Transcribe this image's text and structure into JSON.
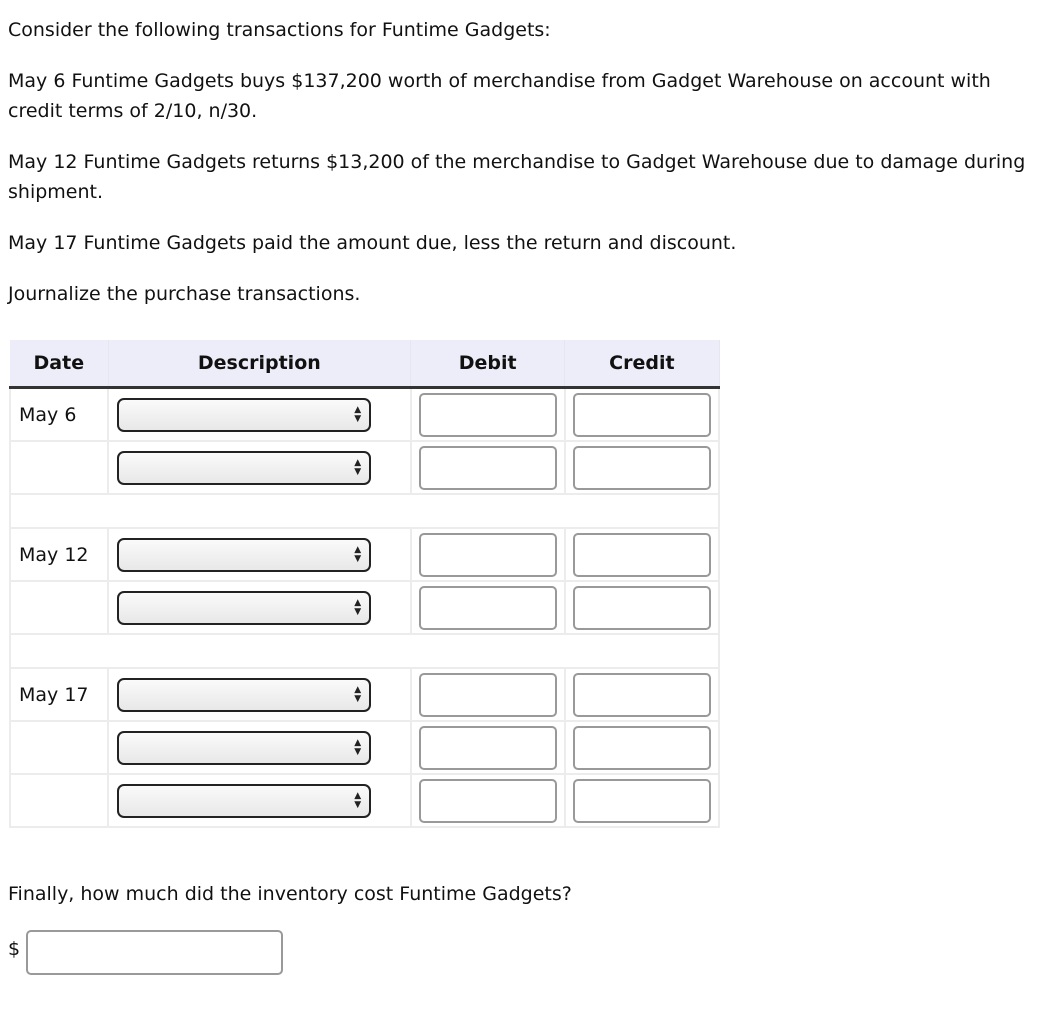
{
  "intro": "Consider the following transactions for Funtime Gadgets:",
  "transactions": [
    "May 6 Funtime Gadgets buys $137,200 worth of merchandise from Gadget Warehouse on account with credit terms of 2/10, n/30.",
    "May 12 Funtime Gadgets returns $13,200 of the merchandise to Gadget Warehouse due to damage during shipment.",
    "May 17 Funtime Gadgets paid the amount due, less the return and discount."
  ],
  "instruction": "Journalize the purchase transactions.",
  "table": {
    "headers": {
      "date": "Date",
      "description": "Description",
      "debit": "Debit",
      "credit": "Credit"
    },
    "dates": [
      "May 6",
      "May 12",
      "May 17"
    ]
  },
  "final_question": "Finally, how much did the inventory cost Funtime Gadgets?",
  "currency_symbol": "$"
}
